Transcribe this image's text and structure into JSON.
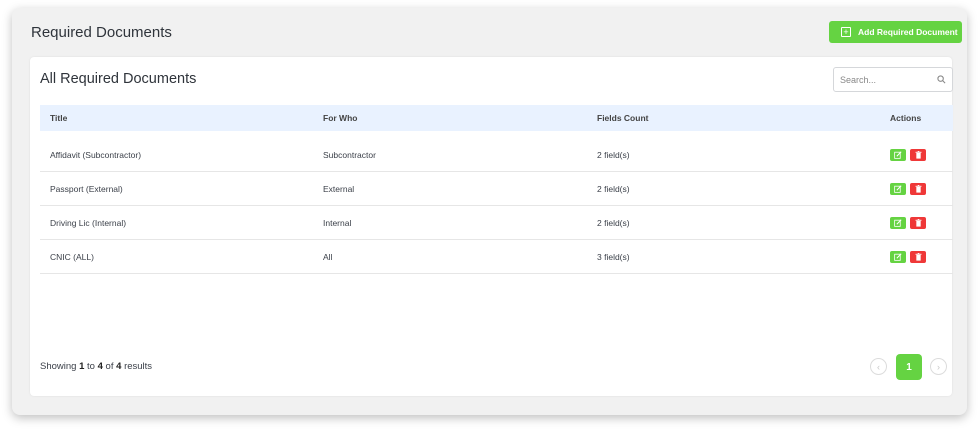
{
  "header": {
    "title": "Required Documents",
    "add_button_label": "Add Required Document"
  },
  "card": {
    "title": "All Required Documents",
    "search_placeholder": "Search..."
  },
  "table": {
    "columns": [
      "Title",
      "For Who",
      "Fields Count",
      "Actions"
    ],
    "rows": [
      {
        "title": "Affidavit (Subcontractor)",
        "for_who": "Subcontractor",
        "fields_count": "2 field(s)"
      },
      {
        "title": "Passport (External)",
        "for_who": "External",
        "fields_count": "2 field(s)"
      },
      {
        "title": "Driving Lic (Internal)",
        "for_who": "Internal",
        "fields_count": "2 field(s)"
      },
      {
        "title": "CNIC (ALL)",
        "for_who": "All",
        "fields_count": "3 field(s)"
      }
    ]
  },
  "footer": {
    "prefix": "Showing",
    "from": "1",
    "to_word": "to",
    "to": "4",
    "of_word": "of",
    "total": "4",
    "suffix": "results"
  },
  "pagination": {
    "current_page": "1"
  },
  "colors": {
    "accent_green": "#65d342",
    "danger_red": "#ef3838",
    "header_row_bg": "#e9f2ff"
  }
}
